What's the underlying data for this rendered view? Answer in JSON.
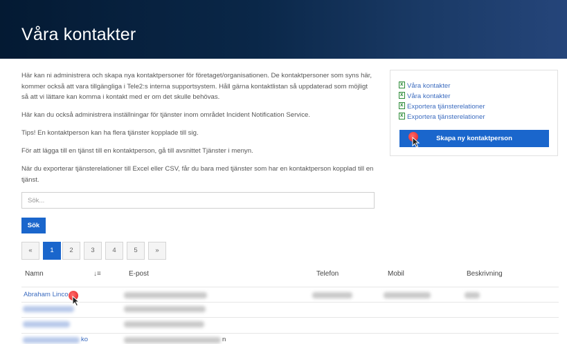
{
  "header": {
    "title": "Våra kontakter"
  },
  "intro": {
    "paragraphs": [
      "Här kan ni administrera och skapa nya kontaktpersoner för företaget/organisationen. De kontaktpersoner som syns här, kommer också att vara tillgängliga i Tele2:s interna supportsystem. Håll gärna kontaktlistan så uppdaterad som möjligt så att vi lättare kan komma i kontakt med er om det skulle behövas.",
      "Här kan du också administrera inställningar för tjänster inom området Incident Notification Service.",
      "Tips! En kontaktperson kan ha flera tjänster kopplade till sig.",
      "För att lägga till en tjänst till en kontaktperson, gå till avsnittet Tjänster i menyn.",
      "När du exporterar tjänsterelationer till Excel eller CSV, får du bara med tjänster som har en kontaktperson kopplad till en tjänst."
    ]
  },
  "search": {
    "placeholder": "Sök...",
    "button_label": "Sök"
  },
  "pager": {
    "prev": "«",
    "pages": [
      "1",
      "2",
      "3",
      "4",
      "5"
    ],
    "next": "»",
    "current": "1"
  },
  "sidebar": {
    "links": [
      "Våra kontakter",
      "Våra kontakter",
      "Exportera tjänsterelationer",
      "Exportera tjänsterelationer"
    ],
    "create_button": "Skapa ny kontaktperson"
  },
  "table": {
    "columns": [
      "Namn",
      "E-post",
      "Telefon",
      "Mobil",
      "Beskrivning"
    ],
    "rows": [
      {
        "name": "Abraham Linco"
      },
      {
        "name": ""
      },
      {
        "name": ""
      },
      {
        "name_suffix": "ko",
        "email_suffix": "n"
      }
    ]
  },
  "colors": {
    "primary": "#1a66cc",
    "link": "#3b6bbf",
    "header_bg": "#041a33"
  },
  "icons": {
    "excel": "excel-file-icon",
    "sort": "sort-alpha-icon"
  }
}
